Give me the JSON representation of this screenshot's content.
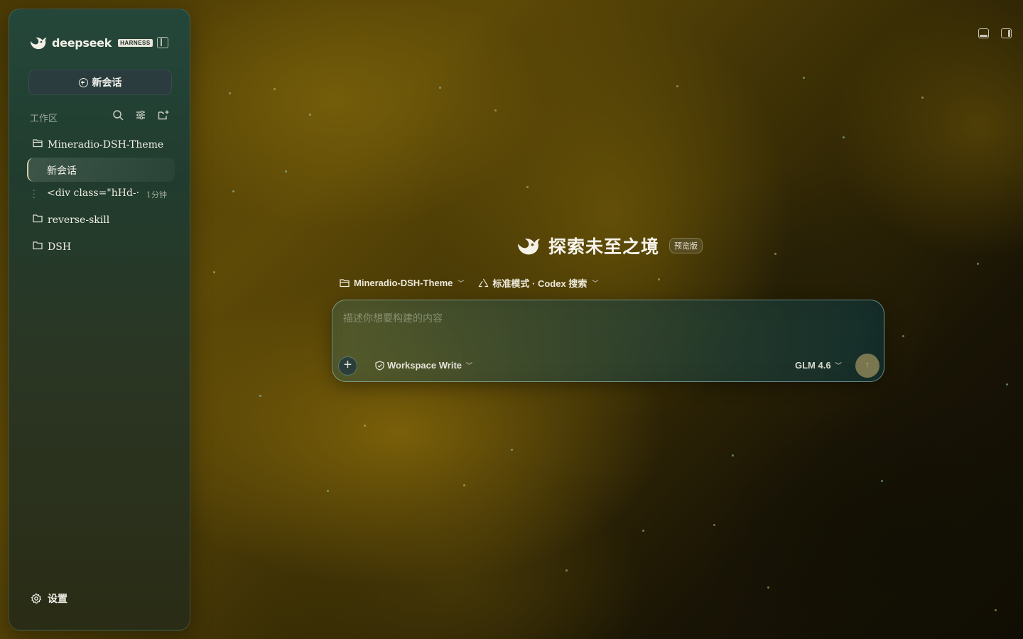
{
  "sidebar": {
    "brand": {
      "name": "deepseek",
      "badge": "HARNESS"
    },
    "new_chat_label": "新会话",
    "workspace_label": "工作区",
    "projects": [
      {
        "name": "Mineradio-DSH-Theme",
        "icon": "folder-open-icon",
        "sessions": [
          {
            "title": "新会话",
            "active": true
          },
          {
            "title": "<div class=\"hHd-···",
            "time": "1分钟"
          }
        ]
      },
      {
        "name": "reverse-skill",
        "icon": "folder-icon"
      },
      {
        "name": "DSH",
        "icon": "folder-icon"
      }
    ],
    "settings_label": "设置"
  },
  "hero": {
    "title": "探索未至之境",
    "badge": "预览版"
  },
  "context": {
    "project": "Mineradio-DSH-Theme",
    "mode": "标准模式 · Codex 搜索"
  },
  "composer": {
    "placeholder": "描述你想要构建的内容",
    "value": "",
    "permission": "Workspace Write",
    "model": "GLM 4.6"
  },
  "colors": {
    "accent": "#d7cfa6",
    "sidebar_top": "#24473a",
    "background": "#4a3a05"
  }
}
